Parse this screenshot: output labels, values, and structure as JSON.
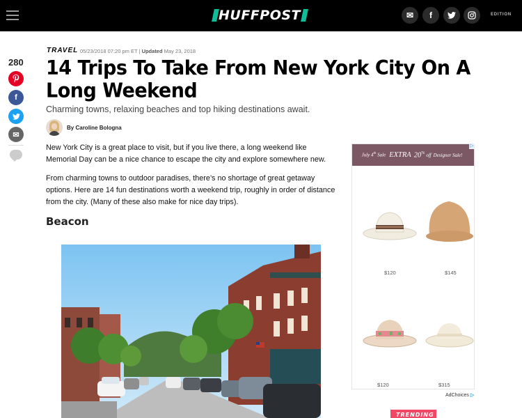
{
  "header": {
    "logo_text": "HUFFPOST",
    "edition_label": "EDITION",
    "social_icons": [
      "email-icon",
      "facebook-icon",
      "twitter-icon",
      "instagram-icon"
    ],
    "brand_color": "#0dbe98"
  },
  "share": {
    "count": "280",
    "buttons": [
      {
        "name": "pinterest-icon",
        "glyph": "P",
        "color": "#e60023"
      },
      {
        "name": "facebook-icon",
        "glyph": "f",
        "color": "#3b5998"
      },
      {
        "name": "twitter-icon",
        "glyph": "t",
        "color": "#1da1f2"
      },
      {
        "name": "email-icon",
        "glyph": "✉",
        "color": "#666666"
      }
    ]
  },
  "article": {
    "kicker": "TRAVEL",
    "published": "05/23/2018 07:20 pm ET",
    "updated_label": "Updated",
    "updated": "May 23, 2018",
    "headline": "14 Trips To Take From New York City On A Long Weekend",
    "dek": "Charming towns, relaxing beaches and top hiking destinations await.",
    "byline_prefix": "By",
    "author": "Caroline Bologna",
    "paragraphs": [
      "New York City is a great place to visit, but if you live there, a long weekend like Memorial Day can be a nice chance to escape the city and explore somewhere new.",
      "From charming towns to outdoor paradises, there’s no shortage of great getaway options. Here are 14 fun destinations worth a weekend trip, roughly in order of distance from the city. (Many of these also make for nice day trips)."
    ],
    "subhead": "Beacon"
  },
  "ad": {
    "banner_prefix": "July 4",
    "banner_sup": "th",
    "banner_sale": "Sale",
    "banner_main": "EXTRA",
    "banner_pct": "20",
    "banner_pct_sup": "%",
    "banner_off": "off",
    "banner_suffix": "Designer Sale!",
    "prices": [
      "$120",
      "$145",
      "$120",
      "$315"
    ],
    "adchoices_label": "AdChoices",
    "accent_color": "#7b5863"
  },
  "trending_label": "TRENDING"
}
